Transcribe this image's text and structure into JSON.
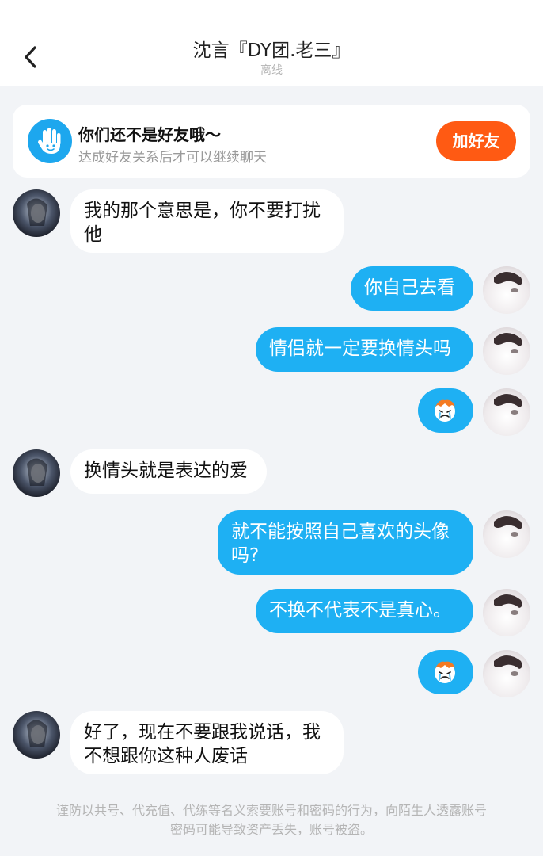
{
  "header": {
    "title": "沈言『DY团.老三』",
    "status": "离线"
  },
  "friend_card": {
    "title": "你们还不是好友哦～",
    "subtitle": "达成好友关系后才可以继续聊天",
    "add_button": "加好友"
  },
  "messages": [
    {
      "side": "in",
      "text_line1": "我的那个意思是，你不要打扰",
      "text_line2": "他"
    },
    {
      "side": "out",
      "text": "你自己去看"
    },
    {
      "side": "out",
      "text": "情侣就一定要换情头吗"
    },
    {
      "side": "out",
      "sticker": "crying-face-sticker"
    },
    {
      "side": "in",
      "text": "换情头就是表达的爱"
    },
    {
      "side": "out",
      "text_line1": "就不能按照自己喜欢的头像",
      "text_line2": "吗?"
    },
    {
      "side": "out",
      "text": "不换不代表不是真心。"
    },
    {
      "side": "out",
      "sticker": "crying-face-sticker"
    },
    {
      "side": "in",
      "text_line1": "好了，现在不要跟我说话，我",
      "text_line2": "不想跟你这种人废话"
    }
  ],
  "notice": {
    "line1": "谨防以共号、代充值、代练等名义索要账号和密码的行为，向陌生人透露账号",
    "line2": "密码可能导致资产丢失，账号被盗。"
  },
  "colors": {
    "outgoing_bubble": "#1eb0f3",
    "incoming_bubble": "#ffffff",
    "add_button": "#ff5a13",
    "background": "#f2f4f7"
  }
}
